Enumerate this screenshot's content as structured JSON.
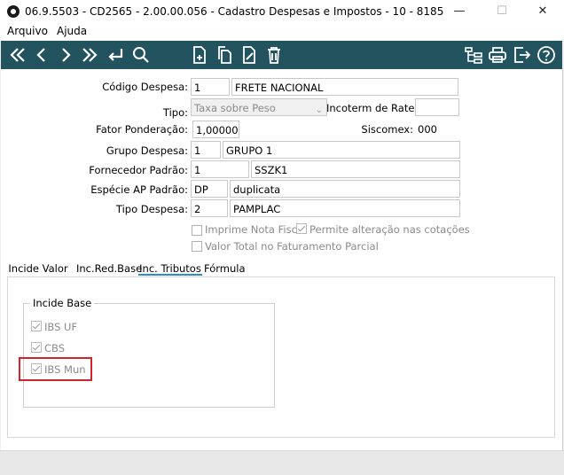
{
  "window": {
    "title": "06.9.5503 - CD2565 - 2.00.00.056 - Cadastro Despesas e Impostos - 10 - 8185",
    "minimize": "—",
    "maximize": "☐",
    "close": "✕"
  },
  "menu": {
    "arquivo": "Arquivo",
    "ajuda": "Ajuda"
  },
  "toolbar": {
    "icons": [
      "first-icon",
      "previous-icon",
      "next-icon",
      "last-icon",
      "return-icon",
      "search-icon",
      "new-document-icon",
      "copy-icon",
      "edit-icon",
      "delete-icon",
      "tree-icon",
      "print-icon",
      "exit-icon",
      "help-icon"
    ],
    "background": "#22535e"
  },
  "form": {
    "codigo_despesa": {
      "label": "Código Despesa:",
      "code": "1",
      "desc": "FRETE NACIONAL"
    },
    "tipo": {
      "label": "Tipo:",
      "value": "Taxa sobre Peso"
    },
    "incoterm": {
      "label": "Incoterm de Rateio:",
      "value": ""
    },
    "fator": {
      "label": "Fator Ponderação:",
      "value": "1,00000"
    },
    "siscomex": {
      "label": "Siscomex:",
      "value": "000"
    },
    "grupo": {
      "label": "Grupo Despesa:",
      "code": "1",
      "desc": "GRUPO 1"
    },
    "fornecedor": {
      "label": "Fornecedor Padrão:",
      "code": "1",
      "desc": "SSZK1"
    },
    "especie": {
      "label": "Espécie AP Padrão:",
      "code": "DP",
      "desc": "duplicata"
    },
    "tipo_despesa": {
      "label": "Tipo Despesa:",
      "code": "2",
      "desc": "PAMPLAC"
    },
    "imprime_nf": {
      "label": "Imprime Nota Fiscal",
      "checked": false
    },
    "permite_alteracao": {
      "label": "Permite alteração nas cotações",
      "checked": true
    },
    "valor_total": {
      "label": "Valor Total no Faturamento Parcial",
      "checked": false
    }
  },
  "tabs": [
    {
      "label": "Incide Valor"
    },
    {
      "label": "Inc.Red.Base"
    },
    {
      "label": "Inc. Tributos"
    },
    {
      "label": "Fórmula"
    }
  ],
  "active_tab": "Inc. Tributos",
  "incide_base": {
    "title": "Incide Base",
    "items": [
      {
        "label": "IBS UF",
        "checked": true
      },
      {
        "label": "CBS",
        "checked": true
      },
      {
        "label": "IBS Mun",
        "checked": true
      }
    ]
  },
  "colors": {
    "accent": "#2a8fc5",
    "highlight": "#d2232a"
  }
}
